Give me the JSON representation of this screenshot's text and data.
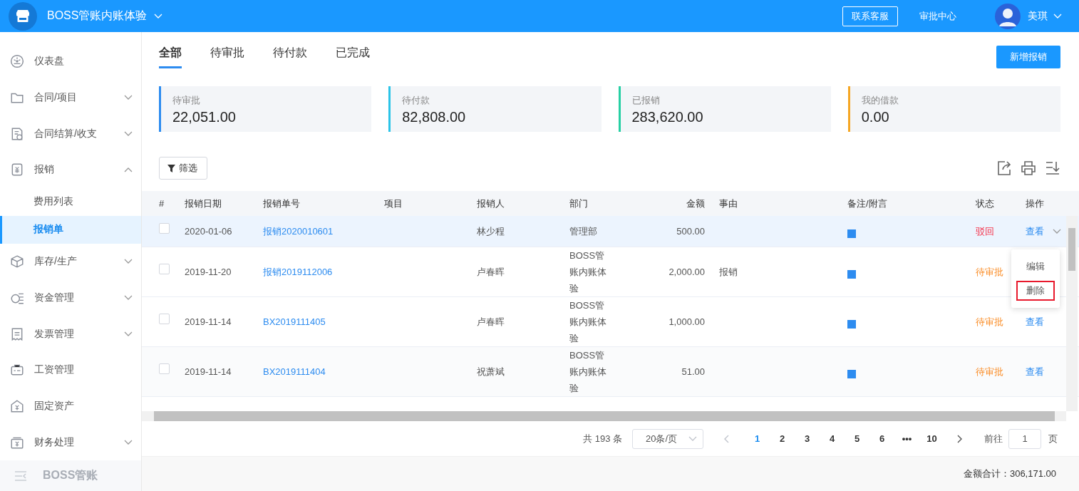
{
  "header": {
    "company": "BOSS管账内账体验",
    "contact_button": "联系客服",
    "approval_link": "审批中心",
    "user": "美琪"
  },
  "sidebar": {
    "items": [
      {
        "label": "仪表盘",
        "selected": false
      },
      {
        "label": "合同/项目",
        "selected": false,
        "expanded": false
      },
      {
        "label": "合同结算/收支",
        "selected": false,
        "expanded": false
      },
      {
        "label": "报销",
        "selected": false,
        "expanded": true,
        "children": [
          {
            "label": "费用列表",
            "selected": false
          },
          {
            "label": "报销单",
            "selected": true
          }
        ]
      },
      {
        "label": "库存/生产",
        "selected": false,
        "expanded": false
      },
      {
        "label": "资金管理",
        "selected": false,
        "expanded": false
      },
      {
        "label": "发票管理",
        "selected": false,
        "expanded": false
      },
      {
        "label": "工资管理",
        "selected": false
      },
      {
        "label": "固定资产",
        "selected": false
      },
      {
        "label": "财务处理",
        "selected": false,
        "expanded": false
      }
    ],
    "footer": "BOSS管账"
  },
  "tabs": [
    {
      "label": "全部",
      "selected": true
    },
    {
      "label": "待审批",
      "selected": false
    },
    {
      "label": "待付款",
      "selected": false
    },
    {
      "label": "已完成",
      "selected": false
    }
  ],
  "new_button": "新增报销",
  "stats": [
    {
      "label": "待审批",
      "value": "22,051.00",
      "color": "#2d8cf0"
    },
    {
      "label": "待付款",
      "value": "82,808.00",
      "color": "#2bc4e8"
    },
    {
      "label": "已报销",
      "value": "283,620.00",
      "color": "#26d0a4"
    },
    {
      "label": "我的借款",
      "value": "0.00",
      "color": "#f5a623"
    }
  ],
  "filter_button": "筛选",
  "table": {
    "columns": [
      "#",
      "报销日期",
      "报销单号",
      "项目",
      "报销人",
      "部门",
      "金额",
      "事由",
      "备注/附言",
      "状态",
      "操作"
    ],
    "rows": [
      {
        "checked": false,
        "selected": true,
        "date": "2020-01-06",
        "number": "报销2020010601",
        "person": "林少程",
        "dept": "管理部",
        "amount": "500.00",
        "reason": "",
        "attachment": true,
        "status": {
          "label": "驳回",
          "color": "#f5334b"
        },
        "action": "查看",
        "menu_open": true
      },
      {
        "checked": false,
        "selected": false,
        "date": "2019-11-20",
        "number": "报销2019112006",
        "person": "卢春晖",
        "dept": "BOSS管账内账体验",
        "amount": "2,000.00",
        "reason": "报销",
        "attachment": true,
        "status": {
          "label": "待审批",
          "color": "#fa8c25"
        },
        "menu_open": false
      },
      {
        "checked": false,
        "selected": false,
        "date": "2019-11-14",
        "number": "BX2019111405",
        "person": "卢春晖",
        "dept": "BOSS管账内账体验",
        "amount": "1,000.00",
        "reason": "",
        "attachment": true,
        "status": {
          "label": "待审批",
          "color": "#fa8c25"
        },
        "action": "查看",
        "menu_open": false
      },
      {
        "checked": false,
        "selected": false,
        "date": "2019-11-14",
        "number": "BX2019111404",
        "person": "祝萧斌",
        "dept": "BOSS管账内账体验",
        "amount": "51.00",
        "reason": "",
        "attachment": true,
        "status": {
          "label": "待审批",
          "color": "#fa8c25"
        },
        "action": "查看",
        "menu_open": false
      }
    ]
  },
  "action_menu": [
    {
      "label": "编辑",
      "focused": false
    },
    {
      "label": "删除",
      "focused": true
    }
  ],
  "pagination": {
    "total": "共 193 条",
    "page_size": "20条/页",
    "pages": [
      {
        "label": "1",
        "selected": true
      },
      {
        "label": "2",
        "selected": false
      },
      {
        "label": "3",
        "selected": false
      },
      {
        "label": "4",
        "selected": false
      },
      {
        "label": "5",
        "selected": false
      },
      {
        "label": "6",
        "selected": false
      },
      {
        "label": "•••",
        "selected": false
      },
      {
        "label": "10",
        "selected": false
      }
    ],
    "goto_label": "前往",
    "goto_value": "1",
    "page_suffix": "页"
  },
  "sum": "金额合计：306,171.00"
}
